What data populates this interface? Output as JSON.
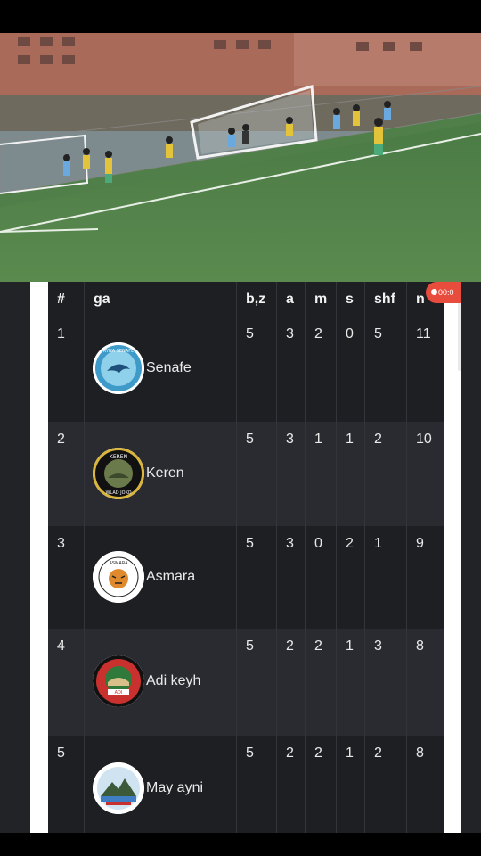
{
  "recording": {
    "timer": "00:0"
  },
  "table": {
    "headers": [
      "#",
      "ga",
      "b,z",
      "a",
      "m",
      "s",
      "shf",
      "n"
    ],
    "rows": [
      {
        "rank": "1",
        "team": "Senafe",
        "logo": "senafe-logo",
        "p": "5",
        "w": "3",
        "d": "2",
        "l": "0",
        "gd": "5",
        "pts": "11"
      },
      {
        "rank": "2",
        "team": "Keren",
        "logo": "keren-logo",
        "p": "5",
        "w": "3",
        "d": "1",
        "l": "1",
        "gd": "2",
        "pts": "10"
      },
      {
        "rank": "3",
        "team": "Asmara",
        "logo": "asmara-logo",
        "p": "5",
        "w": "3",
        "d": "0",
        "l": "2",
        "gd": "1",
        "pts": "9"
      },
      {
        "rank": "4",
        "team": "Adi keyh",
        "logo": "adi-keyh-logo",
        "p": "5",
        "w": "2",
        "d": "2",
        "l": "1",
        "gd": "3",
        "pts": "8"
      },
      {
        "rank": "5",
        "team": "May ayni",
        "logo": "may-ayni-logo",
        "p": "5",
        "w": "2",
        "d": "2",
        "l": "1",
        "gd": "2",
        "pts": "8"
      }
    ],
    "logo_labels": {
      "senafe": "RYNA SENAFE",
      "keren": "KEREN",
      "keren_sub": "WLAD JOKO",
      "asmara": "ASMARA",
      "adi_keyh": "ADI"
    }
  },
  "colors": {
    "row_dark": "#1e1f23",
    "row_mid": "#2a2b30",
    "header": "#1e1f23",
    "accent_record": "#e74c3c"
  }
}
